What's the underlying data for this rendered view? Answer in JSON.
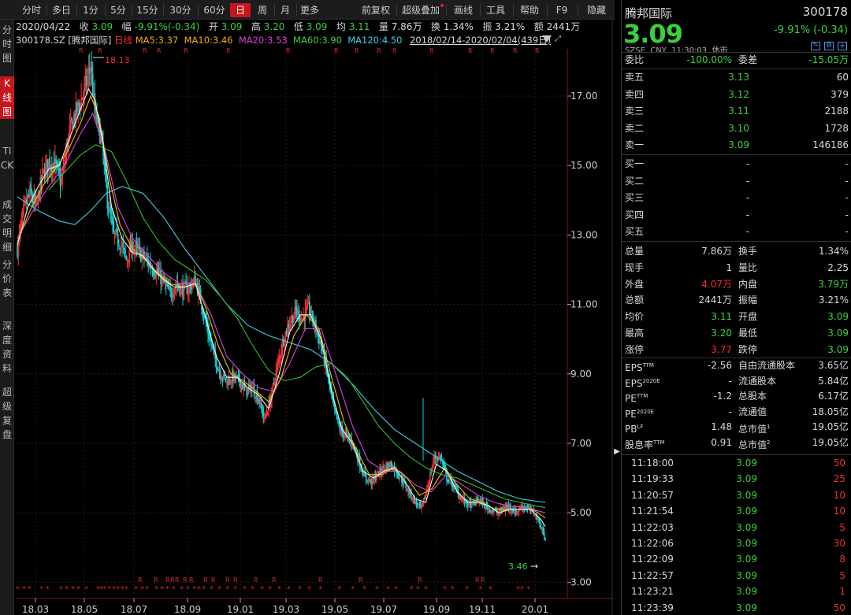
{
  "toolbar": {
    "buttons": [
      "分时",
      "多日",
      "1分",
      "5分",
      "15分",
      "30分",
      "60分",
      "日",
      "周",
      "月",
      "更多"
    ],
    "active": "日",
    "right_buttons": [
      "前复权",
      "超级叠加",
      "画线",
      "工具",
      "帮助",
      "F9",
      "隐藏"
    ]
  },
  "left_tabs": [
    "分时图",
    "K线图",
    "TICK",
    "成交明细",
    "分价表",
    "深度资料",
    "超级复盘"
  ],
  "info": {
    "date": "2020/04/22",
    "close_label": "收",
    "close": "3.09",
    "change_label": "幅",
    "change": "-9.91%(-0.34)",
    "open_label": "开",
    "open": "3.09",
    "high_label": "高",
    "high": "3.20",
    "low_label": "低",
    "low": "3.09",
    "avg_label": "均",
    "avg": "3.11",
    "vol_label": "量",
    "vol": "7.86万",
    "turnover_label": "换",
    "turnover": "1.34%",
    "amp_label": "振",
    "amp": "3.21%",
    "amount_label": "额",
    "amount": "2441万"
  },
  "legend": {
    "code": "300178.SZ",
    "name": "[腾邦国际]",
    "period": "日线",
    "ma5": "MA5:3.37",
    "ma10": "MA10:3.46",
    "ma20": "MA20:3.53",
    "ma60": "MA60:3.90",
    "ma120": "MA120:4.50",
    "range": "2018/02/14-2020/02/04(439日)"
  },
  "chart_data": {
    "type": "candlestick",
    "y_ticks": [
      "17.00",
      "15.00",
      "13.00",
      "11.00",
      "9.00",
      "7.00",
      "5.00",
      "3.00"
    ],
    "ylim": [
      2.72,
      18.7
    ],
    "x_ticks": [
      "18.03",
      "18.05",
      "18.07",
      "18.09",
      "19.01",
      "19.03",
      "19.05",
      "19.07",
      "19.09",
      "19.11",
      "20.01"
    ],
    "max_label": "18.13",
    "min_label": "3.46",
    "close_path": [
      [
        0,
        12.6
      ],
      [
        6,
        13.7
      ],
      [
        12,
        14.2
      ],
      [
        18,
        13.8
      ],
      [
        24,
        14.7
      ],
      [
        30,
        15.1
      ],
      [
        36,
        15.0
      ],
      [
        42,
        14.5
      ],
      [
        48,
        15.7
      ],
      [
        54,
        16.4
      ],
      [
        60,
        16.8
      ],
      [
        66,
        17.4
      ],
      [
        70,
        17.9
      ],
      [
        74,
        16.5
      ],
      [
        80,
        15.8
      ],
      [
        86,
        14.0
      ],
      [
        92,
        13.0
      ],
      [
        98,
        12.8
      ],
      [
        104,
        12.3
      ],
      [
        110,
        12.7
      ],
      [
        116,
        12.5
      ],
      [
        122,
        12.3
      ],
      [
        128,
        12.1
      ],
      [
        134,
        11.9
      ],
      [
        140,
        11.6
      ],
      [
        146,
        11.3
      ],
      [
        152,
        11.6
      ],
      [
        158,
        11.4
      ],
      [
        164,
        11.5
      ],
      [
        170,
        11.7
      ],
      [
        176,
        11.0
      ],
      [
        182,
        10.2
      ],
      [
        188,
        9.5
      ],
      [
        194,
        9.0
      ],
      [
        200,
        8.8
      ],
      [
        206,
        8.9
      ],
      [
        212,
        8.8
      ],
      [
        218,
        8.5
      ],
      [
        224,
        8.6
      ],
      [
        230,
        8.3
      ],
      [
        236,
        7.7
      ],
      [
        242,
        8.3
      ],
      [
        248,
        9.2
      ],
      [
        254,
        10.0
      ],
      [
        260,
        10.5
      ],
      [
        266,
        10.8
      ],
      [
        272,
        10.6
      ],
      [
        278,
        10.9
      ],
      [
        284,
        10.4
      ],
      [
        290,
        9.8
      ],
      [
        296,
        9.0
      ],
      [
        302,
        8.0
      ],
      [
        308,
        7.4
      ],
      [
        314,
        7.2
      ],
      [
        320,
        7.0
      ],
      [
        326,
        6.5
      ],
      [
        332,
        6.0
      ],
      [
        338,
        5.9
      ],
      [
        344,
        6.1
      ],
      [
        350,
        6.3
      ],
      [
        356,
        6.4
      ],
      [
        362,
        6.2
      ],
      [
        368,
        5.9
      ],
      [
        374,
        5.6
      ],
      [
        380,
        5.3
      ],
      [
        386,
        5.1
      ],
      [
        392,
        5.8
      ],
      [
        398,
        6.6
      ],
      [
        404,
        6.6
      ],
      [
        410,
        6.0
      ],
      [
        416,
        5.8
      ],
      [
        422,
        5.5
      ],
      [
        428,
        5.3
      ],
      [
        434,
        5.2
      ],
      [
        440,
        5.4
      ],
      [
        446,
        5.2
      ],
      [
        452,
        5.1
      ],
      [
        458,
        5.0
      ],
      [
        464,
        5.1
      ],
      [
        470,
        5.2
      ],
      [
        476,
        5.0
      ],
      [
        482,
        5.2
      ],
      [
        488,
        5.1
      ],
      [
        494,
        5.0
      ],
      [
        500,
        4.6
      ],
      [
        504,
        4.2
      ]
    ],
    "ma5": [
      [
        0,
        12.7
      ],
      [
        10,
        13.8
      ],
      [
        20,
        14.4
      ],
      [
        30,
        14.9
      ],
      [
        40,
        15.0
      ],
      [
        50,
        15.8
      ],
      [
        60,
        16.6
      ],
      [
        68,
        17.2
      ],
      [
        74,
        16.9
      ],
      [
        82,
        15.6
      ],
      [
        90,
        13.8
      ],
      [
        100,
        12.9
      ],
      [
        110,
        12.5
      ],
      [
        120,
        12.4
      ],
      [
        130,
        12.0
      ],
      [
        140,
        11.7
      ],
      [
        150,
        11.5
      ],
      [
        160,
        11.5
      ],
      [
        170,
        11.6
      ],
      [
        180,
        10.6
      ],
      [
        190,
        9.5
      ],
      [
        200,
        8.9
      ],
      [
        210,
        8.9
      ],
      [
        220,
        8.6
      ],
      [
        230,
        8.4
      ],
      [
        240,
        8.0
      ],
      [
        250,
        9.0
      ],
      [
        260,
        10.2
      ],
      [
        270,
        10.7
      ],
      [
        280,
        10.7
      ],
      [
        290,
        10.0
      ],
      [
        300,
        8.5
      ],
      [
        310,
        7.4
      ],
      [
        320,
        7.0
      ],
      [
        330,
        6.2
      ],
      [
        340,
        6.0
      ],
      [
        350,
        6.2
      ],
      [
        360,
        6.3
      ],
      [
        370,
        5.9
      ],
      [
        380,
        5.4
      ],
      [
        390,
        5.3
      ],
      [
        400,
        6.4
      ],
      [
        410,
        6.2
      ],
      [
        420,
        5.6
      ],
      [
        430,
        5.3
      ],
      [
        440,
        5.3
      ],
      [
        450,
        5.2
      ],
      [
        460,
        5.0
      ],
      [
        470,
        5.1
      ],
      [
        480,
        5.1
      ],
      [
        490,
        5.1
      ],
      [
        500,
        4.8
      ],
      [
        504,
        4.6
      ]
    ],
    "ma10": [
      [
        0,
        12.8
      ],
      [
        12,
        13.7
      ],
      [
        24,
        14.4
      ],
      [
        36,
        14.9
      ],
      [
        48,
        15.4
      ],
      [
        60,
        16.2
      ],
      [
        70,
        17.0
      ],
      [
        78,
        16.4
      ],
      [
        88,
        14.6
      ],
      [
        98,
        13.3
      ],
      [
        110,
        12.6
      ],
      [
        122,
        12.3
      ],
      [
        134,
        11.9
      ],
      [
        146,
        11.6
      ],
      [
        158,
        11.5
      ],
      [
        170,
        11.6
      ],
      [
        180,
        10.9
      ],
      [
        192,
        9.8
      ],
      [
        204,
        9.0
      ],
      [
        216,
        8.8
      ],
      [
        228,
        8.5
      ],
      [
        240,
        8.2
      ],
      [
        252,
        8.9
      ],
      [
        264,
        10.1
      ],
      [
        276,
        10.7
      ],
      [
        288,
        10.3
      ],
      [
        300,
        8.9
      ],
      [
        312,
        7.6
      ],
      [
        324,
        6.8
      ],
      [
        336,
        6.1
      ],
      [
        348,
        6.1
      ],
      [
        360,
        6.3
      ],
      [
        372,
        6.0
      ],
      [
        384,
        5.5
      ],
      [
        396,
        5.7
      ],
      [
        408,
        6.3
      ],
      [
        420,
        5.8
      ],
      [
        432,
        5.4
      ],
      [
        444,
        5.3
      ],
      [
        456,
        5.1
      ],
      [
        468,
        5.1
      ],
      [
        480,
        5.1
      ],
      [
        492,
        5.1
      ],
      [
        504,
        4.85
      ]
    ],
    "ma20": [
      [
        0,
        12.9
      ],
      [
        15,
        13.7
      ],
      [
        30,
        14.4
      ],
      [
        45,
        15.0
      ],
      [
        60,
        15.9
      ],
      [
        72,
        16.5
      ],
      [
        84,
        15.4
      ],
      [
        96,
        13.8
      ],
      [
        110,
        12.9
      ],
      [
        125,
        12.4
      ],
      [
        140,
        11.9
      ],
      [
        155,
        11.6
      ],
      [
        170,
        11.6
      ],
      [
        185,
        10.7
      ],
      [
        200,
        9.5
      ],
      [
        215,
        9.0
      ],
      [
        230,
        8.6
      ],
      [
        245,
        8.5
      ],
      [
        260,
        9.3
      ],
      [
        275,
        10.3
      ],
      [
        290,
        10.3
      ],
      [
        305,
        8.9
      ],
      [
        320,
        7.5
      ],
      [
        335,
        6.5
      ],
      [
        350,
        6.2
      ],
      [
        365,
        6.2
      ],
      [
        380,
        5.8
      ],
      [
        395,
        5.6
      ],
      [
        410,
        6.1
      ],
      [
        425,
        5.8
      ],
      [
        440,
        5.5
      ],
      [
        455,
        5.3
      ],
      [
        470,
        5.2
      ],
      [
        485,
        5.15
      ],
      [
        504,
        5.0
      ]
    ],
    "ma60": [
      [
        30,
        14.3
      ],
      [
        45,
        14.8
      ],
      [
        60,
        15.3
      ],
      [
        75,
        15.6
      ],
      [
        90,
        15.4
      ],
      [
        105,
        14.5
      ],
      [
        120,
        13.5
      ],
      [
        135,
        12.8
      ],
      [
        150,
        12.3
      ],
      [
        165,
        12.0
      ],
      [
        180,
        11.7
      ],
      [
        195,
        11.2
      ],
      [
        210,
        10.6
      ],
      [
        225,
        9.8
      ],
      [
        240,
        9.1
      ],
      [
        255,
        8.8
      ],
      [
        270,
        8.9
      ],
      [
        285,
        9.2
      ],
      [
        300,
        9.3
      ],
      [
        315,
        8.9
      ],
      [
        330,
        8.2
      ],
      [
        345,
        7.5
      ],
      [
        360,
        7.0
      ],
      [
        375,
        6.6
      ],
      [
        390,
        6.3
      ],
      [
        405,
        6.1
      ],
      [
        420,
        6.0
      ],
      [
        435,
        5.8
      ],
      [
        450,
        5.6
      ],
      [
        465,
        5.4
      ],
      [
        480,
        5.3
      ],
      [
        495,
        5.2
      ],
      [
        504,
        5.15
      ]
    ],
    "ma120": [
      [
        0,
        14.1
      ],
      [
        20,
        13.7
      ],
      [
        40,
        13.4
      ],
      [
        55,
        13.3
      ],
      [
        70,
        13.7
      ],
      [
        85,
        14.2
      ],
      [
        100,
        14.4
      ],
      [
        120,
        14.2
      ],
      [
        140,
        13.5
      ],
      [
        160,
        12.6
      ],
      [
        180,
        11.8
      ],
      [
        200,
        11.0
      ],
      [
        220,
        10.4
      ],
      [
        240,
        10.1
      ],
      [
        260,
        9.9
      ],
      [
        280,
        9.7
      ],
      [
        300,
        9.3
      ],
      [
        320,
        8.7
      ],
      [
        340,
        8.0
      ],
      [
        360,
        7.4
      ],
      [
        380,
        7.0
      ],
      [
        400,
        6.6
      ],
      [
        420,
        6.2
      ],
      [
        440,
        5.9
      ],
      [
        460,
        5.6
      ],
      [
        480,
        5.4
      ],
      [
        504,
        5.3
      ]
    ]
  },
  "right": {
    "name": "腾邦国际",
    "code": "300178",
    "price": "3.09",
    "change": "-9.91% (-0.34)",
    "market": "SZSE",
    "currency": "CNY",
    "time": "11:30:03",
    "status": "休市",
    "webi_label": "委比",
    "webi": "-100.00%",
    "wecha_label": "委差",
    "wecha": "-15.05万",
    "sells": [
      {
        "label": "卖五",
        "price": "3.13",
        "vol": "60"
      },
      {
        "label": "卖四",
        "price": "3.12",
        "vol": "379"
      },
      {
        "label": "卖三",
        "price": "3.11",
        "vol": "2188"
      },
      {
        "label": "卖二",
        "price": "3.10",
        "vol": "1728"
      },
      {
        "label": "卖一",
        "price": "3.09",
        "vol": "146186"
      }
    ],
    "buys": [
      {
        "label": "买一",
        "price": "-",
        "vol": "-"
      },
      {
        "label": "买二",
        "price": "-",
        "vol": "-"
      },
      {
        "label": "买三",
        "price": "-",
        "vol": "-"
      },
      {
        "label": "买四",
        "price": "-",
        "vol": "-"
      },
      {
        "label": "买五",
        "price": "-",
        "vol": "-"
      }
    ],
    "stats": [
      {
        "l1": "总量",
        "v1": "7.86万",
        "c1": "w",
        "l2": "换手",
        "v2": "1.34%",
        "c2": "w"
      },
      {
        "l1": "现手",
        "v1": "1",
        "c1": "w",
        "l2": "量比",
        "v2": "2.25",
        "c2": "w"
      },
      {
        "l1": "外盘",
        "v1": "4.07万",
        "c1": "r",
        "l2": "内盘",
        "v2": "3.79万",
        "c2": "g"
      },
      {
        "l1": "总额",
        "v1": "2441万",
        "c1": "w",
        "l2": "振幅",
        "v2": "3.21%",
        "c2": "w"
      },
      {
        "l1": "均价",
        "v1": "3.11",
        "c1": "g",
        "l2": "开盘",
        "v2": "3.09",
        "c2": "g"
      },
      {
        "l1": "最高",
        "v1": "3.20",
        "c1": "g",
        "l2": "最低",
        "v2": "3.09",
        "c2": "g"
      },
      {
        "l1": "涨停",
        "v1": "3.77",
        "c1": "r",
        "l2": "跌停",
        "v2": "3.09",
        "c2": "g"
      }
    ],
    "fund": [
      {
        "l1": "EPS",
        "s1": "TTM",
        "v1": "-2.56",
        "l2": "自由流通股本",
        "s2": "",
        "v2": "3.65亿"
      },
      {
        "l1": "EPS",
        "s1": "2020E",
        "v1": "-",
        "l2": "流通股本",
        "s2": "",
        "v2": "5.84亿"
      },
      {
        "l1": "PE",
        "s1": "TTM",
        "v1": "-1.2",
        "l2": "总股本",
        "s2": "",
        "v2": "6.17亿"
      },
      {
        "l1": "PE",
        "s1": "2020E",
        "v1": "-",
        "l2": "流通值",
        "s2": "",
        "v2": "18.05亿"
      },
      {
        "l1": "PB",
        "s1": "LF",
        "v1": "1.48",
        "l2": "总市值",
        "s2": "1",
        "v2": "19.05亿"
      },
      {
        "l1": "股息率",
        "s1": "TTM",
        "v1": "0.91",
        "l2": "总市值",
        "s2": "2",
        "v2": "19.05亿"
      }
    ],
    "ticks": [
      {
        "t": "11:18:00",
        "p": "3.09",
        "v": "50"
      },
      {
        "t": "11:19:33",
        "p": "3.09",
        "v": "25"
      },
      {
        "t": "11:20:57",
        "p": "3.09",
        "v": "10"
      },
      {
        "t": "11:21:54",
        "p": "3.09",
        "v": "10"
      },
      {
        "t": "11:22:03",
        "p": "3.09",
        "v": "5"
      },
      {
        "t": "11:22:06",
        "p": "3.09",
        "v": "30"
      },
      {
        "t": "11:22:09",
        "p": "3.09",
        "v": "8"
      },
      {
        "t": "11:22:57",
        "p": "3.09",
        "v": "5"
      },
      {
        "t": "11:23:21",
        "p": "3.09",
        "v": "1"
      },
      {
        "t": "11:23:39",
        "p": "3.09",
        "v": "50"
      }
    ]
  },
  "colors": {
    "up": "#ff3232",
    "down": "#00d8d8",
    "green": "#3cd03c",
    "ma5": "#f0f0f0",
    "ma10": "#f0c000",
    "ma20": "#e040e0",
    "ma60": "#30c030",
    "ma120": "#40d0e0"
  }
}
